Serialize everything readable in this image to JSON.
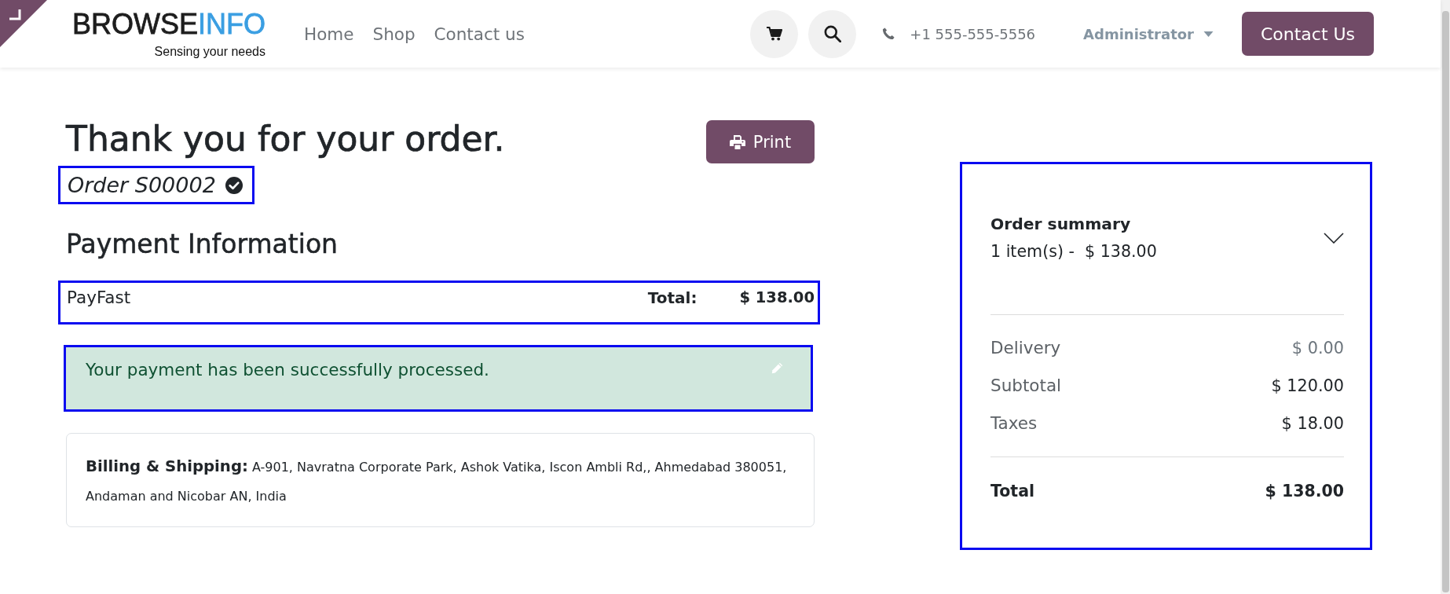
{
  "header": {
    "logo": {
      "wordmark": [
        "BROWSE",
        "INFO"
      ],
      "tagline": "Sensing your needs"
    },
    "nav": [
      {
        "label": "Home"
      },
      {
        "label": "Shop"
      },
      {
        "label": "Contact us"
      }
    ],
    "phone": "+1 555-555-5556",
    "user_menu": "Administrator",
    "cta": "Contact Us"
  },
  "order": {
    "title": "Thank you for your order.",
    "print_label": "Print",
    "order_ref": "Order S00002",
    "confirmed": true,
    "highlighted": true
  },
  "payment": {
    "heading": "Payment Information",
    "method": "PayFast",
    "total_label": "Total:",
    "total": "$ 138.00",
    "highlighted": true
  },
  "alert": {
    "message": "Your payment has been successfully processed.",
    "highlighted": true
  },
  "billing": {
    "text": "**Billing & Shipping:** A-901, Navratna Corporate Park, Ashok Vatika, Iscon Ambli Rd,, Ahmedabad 380051, Andaman and Nicobar AN, India"
  },
  "summary": {
    "title": "Order summary",
    "subtitle": "1 item(s) -  $ 138.00",
    "expanded": false,
    "highlighted": true,
    "rows": [
      {
        "label": "Delivery",
        "value": "$ 0.00",
        "muted": true
      },
      {
        "label": "Subtotal",
        "value": "$ 120.00",
        "muted": false
      },
      {
        "label": "Taxes",
        "value": "$ 18.00",
        "muted": false
      }
    ],
    "total_label": "Total",
    "total": "$ 138.00"
  }
}
